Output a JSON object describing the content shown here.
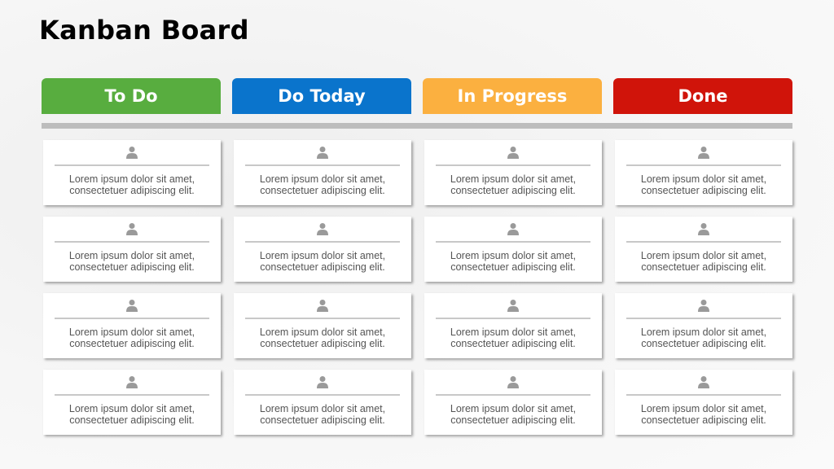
{
  "title": "Kanban Board",
  "columns": [
    {
      "label": "To Do",
      "color": "#58ad3f",
      "cards": [
        {
          "icon": "user-icon",
          "text": "Lorem ipsum dolor sit amet, consectetuer adipiscing elit."
        },
        {
          "icon": "user-icon",
          "text": "Lorem ipsum dolor sit amet, consectetuer adipiscing elit."
        },
        {
          "icon": "user-icon",
          "text": "Lorem ipsum dolor sit amet, consectetuer adipiscing elit."
        },
        {
          "icon": "user-icon",
          "text": "Lorem ipsum dolor sit amet, consectetuer adipiscing elit."
        }
      ]
    },
    {
      "label": "Do Today",
      "color": "#0a74cc",
      "cards": [
        {
          "icon": "user-icon",
          "text": "Lorem ipsum dolor sit amet, consectetuer adipiscing elit."
        },
        {
          "icon": "user-icon",
          "text": "Lorem ipsum dolor sit amet, consectetuer adipiscing elit."
        },
        {
          "icon": "user-icon",
          "text": "Lorem ipsum dolor sit amet, consectetuer adipiscing elit."
        },
        {
          "icon": "user-icon",
          "text": "Lorem ipsum dolor sit amet, consectetuer adipiscing elit."
        }
      ]
    },
    {
      "label": "In Progress",
      "color": "#fbb040",
      "cards": [
        {
          "icon": "user-icon",
          "text": "Lorem ipsum dolor sit amet, consectetuer adipiscing elit."
        },
        {
          "icon": "user-icon",
          "text": "Lorem ipsum dolor sit amet, consectetuer adipiscing elit."
        },
        {
          "icon": "user-icon",
          "text": "Lorem ipsum dolor sit amet, consectetuer adipiscing elit."
        },
        {
          "icon": "user-icon",
          "text": "Lorem ipsum dolor sit amet, consectetuer adipiscing elit."
        }
      ]
    },
    {
      "label": "Done",
      "color": "#d0140a",
      "cards": [
        {
          "icon": "user-icon",
          "text": "Lorem ipsum dolor sit amet, consectetuer adipiscing elit."
        },
        {
          "icon": "user-icon",
          "text": "Lorem ipsum dolor sit amet, consectetuer adipiscing elit."
        },
        {
          "icon": "user-icon",
          "text": "Lorem ipsum dolor sit amet, consectetuer adipiscing elit."
        },
        {
          "icon": "user-icon",
          "text": "Lorem ipsum dolor sit amet, consectetuer adipiscing elit."
        }
      ]
    }
  ]
}
